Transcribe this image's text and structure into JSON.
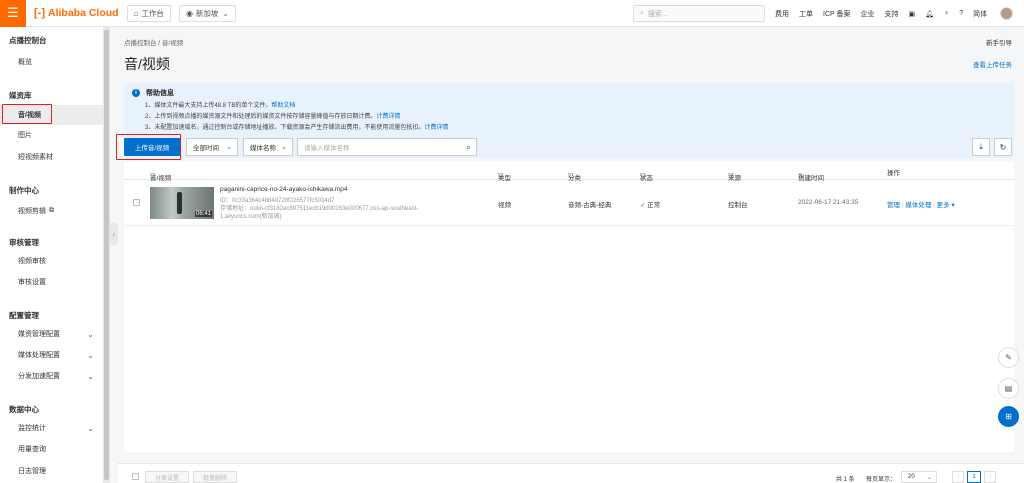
{
  "top": {
    "logo": "Alibaba Cloud",
    "workbench": "工作台",
    "region": "新加坡",
    "search_placeholder": "搜索...",
    "nav": [
      "费用",
      "工单",
      "ICP 备案",
      "企业",
      "支持"
    ],
    "lang": "简体"
  },
  "sidebar": {
    "title": "点播控制台",
    "overview": "概览",
    "media_library": "媒资库",
    "audio_video": "音/视频",
    "image": "图片",
    "short_video": "短视频素材",
    "production_center": "制作中心",
    "video_editing": "视频剪辑",
    "review": "审核管理",
    "video_review": "视频审核",
    "review_settings": "审核设置",
    "config": "配置管理",
    "media_config": "媒资管理配置",
    "processing_config": "媒体处理配置",
    "distribution_config": "分发加速配置",
    "data_center": "数据中心",
    "monitoring": "监控统计",
    "usage_query": "用量查询",
    "log_management": "日志管理"
  },
  "main": {
    "breadcrumb": "点播控制台 / 音/视频",
    "guide": "新手引导",
    "title": "音/视频",
    "tasks": "查看上传任务",
    "help": {
      "title": "帮助信息",
      "line1": "1、媒体文件最大支持上传48.8 TB的单个文件。",
      "line1_link": "帮助文档",
      "line2": "2、上传到视频点播的媒资源文件和处理后的媒资文件按存储容量峰值与存放日期计费。",
      "line2_link": "计费详情",
      "line3": "3、未配置加速域名，通过控制台或存储地址播放、下载资源会产生存储流出费用，不能使用流量包抵扣。",
      "line3_link": "计费详情"
    },
    "upload_button": "上传音/视频",
    "time_filter": "全部时间",
    "name_filter": "媒体名称",
    "search_placeholder": "请输入媒体名称"
  },
  "table": {
    "headers": {
      "media": "音/视频",
      "type": "类型",
      "category": "分类",
      "status": "状态",
      "source": "来源",
      "created": "创建时间",
      "actions": "操作"
    },
    "row": {
      "title": "paganini-caprice-no-24-ayako-ishikawa.mp4",
      "id": "ID：0c33a364c4b848728f226577fc5034d7",
      "path1": "存储地址：outin-cf3182ac897511ecb19d00163e000677.oss-ap-southeast-",
      "path2": "1.aliyuncs.com(新加坡)",
      "duration": "06:41",
      "type": "视频",
      "category": "音频-古典-经典",
      "status": "正常",
      "source": "控制台",
      "created": "2022-06-17 21:43:35",
      "manage": "管理",
      "processing": "媒体处理",
      "more": "更多"
    }
  },
  "footer": {
    "assign_category": "分类设置",
    "batch_delete": "批量删除",
    "total": "共 1 条",
    "per_page_label": "每页显示：",
    "per_page": "20",
    "page": "1"
  }
}
